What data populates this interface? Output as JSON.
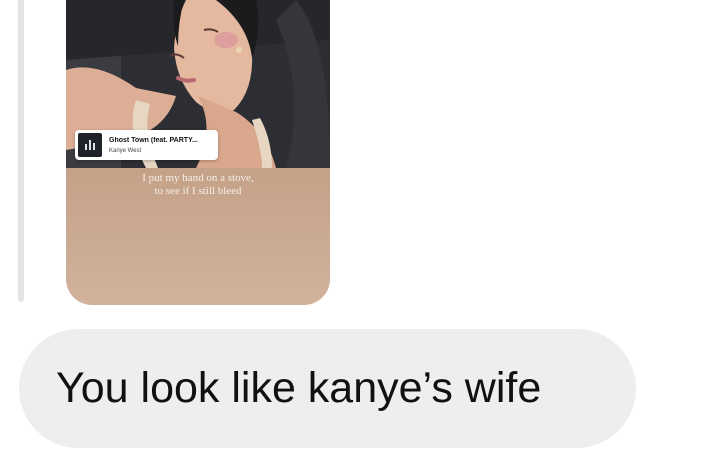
{
  "story_reply": {
    "music_sticker": {
      "song_title": "Ghost Town (feat. PARTY...",
      "artist": "Kanye West",
      "album_icon": "sound-wave-icon"
    },
    "lyrics": {
      "line1": "I put my hand on a stove,",
      "line2": "to see if I still bleed"
    }
  },
  "message": {
    "text": "You look like kanye’s wife"
  }
}
